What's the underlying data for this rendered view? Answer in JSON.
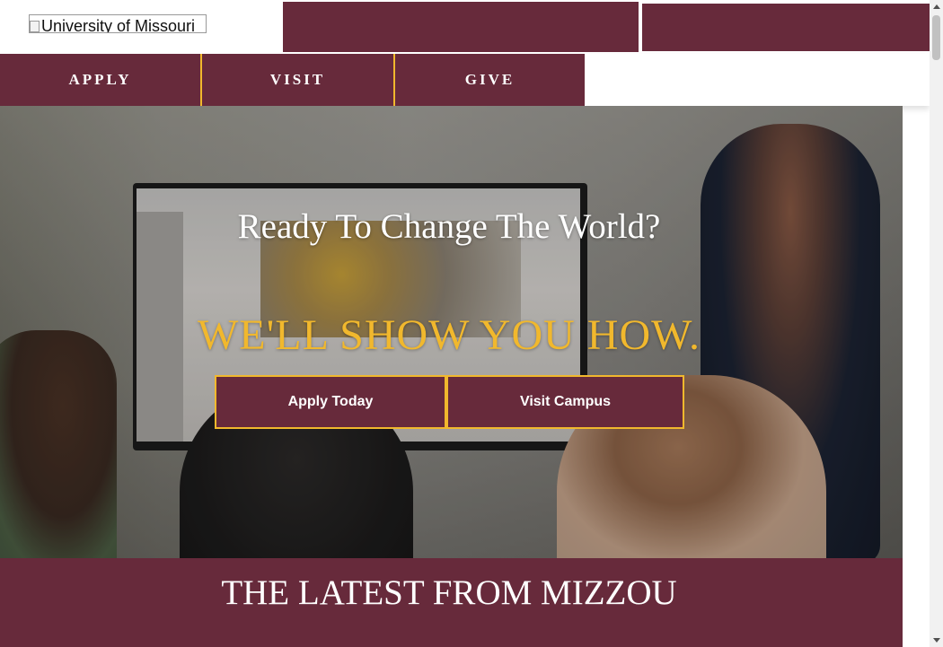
{
  "header": {
    "logo_alt": "University of Missouri",
    "nav": [
      {
        "label": "APPLY"
      },
      {
        "label": "VISIT"
      },
      {
        "label": "GIVE"
      }
    ]
  },
  "hero": {
    "title": "Ready To Change The World?",
    "subtitle": "WE'LL SHOW YOU HOW.",
    "buttons": [
      {
        "label": "Apply Today"
      },
      {
        "label": "Visit Campus"
      }
    ]
  },
  "latest": {
    "title": "THE LATEST FROM MIZZOU"
  },
  "colors": {
    "brand_black_gold_gold": "#f1b82d",
    "brand_maroon": "#672a3b",
    "text_white": "#ffffff"
  }
}
